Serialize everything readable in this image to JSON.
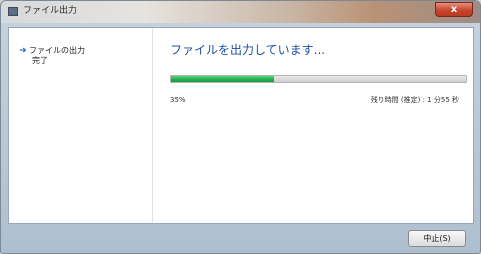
{
  "window": {
    "title": "ファイル出力",
    "close_glyph": "x"
  },
  "sidebar": {
    "items": [
      {
        "label": "ファイルの出力",
        "current": true,
        "icon": "arrow-right-icon",
        "icon_glyph": "➜"
      },
      {
        "label": "完了",
        "current": false
      }
    ]
  },
  "main": {
    "heading": "ファイルを出力しています...",
    "progress": {
      "percent_label": "35%",
      "fraction": 0.35,
      "remaining_label": "残り時間 (推定) : 1 分55 秒"
    }
  },
  "footer": {
    "stop_label": "中止(S)"
  },
  "colors": {
    "accent": "#1d4fa7",
    "progress": "#22ad4c",
    "close": "#c8462c"
  }
}
